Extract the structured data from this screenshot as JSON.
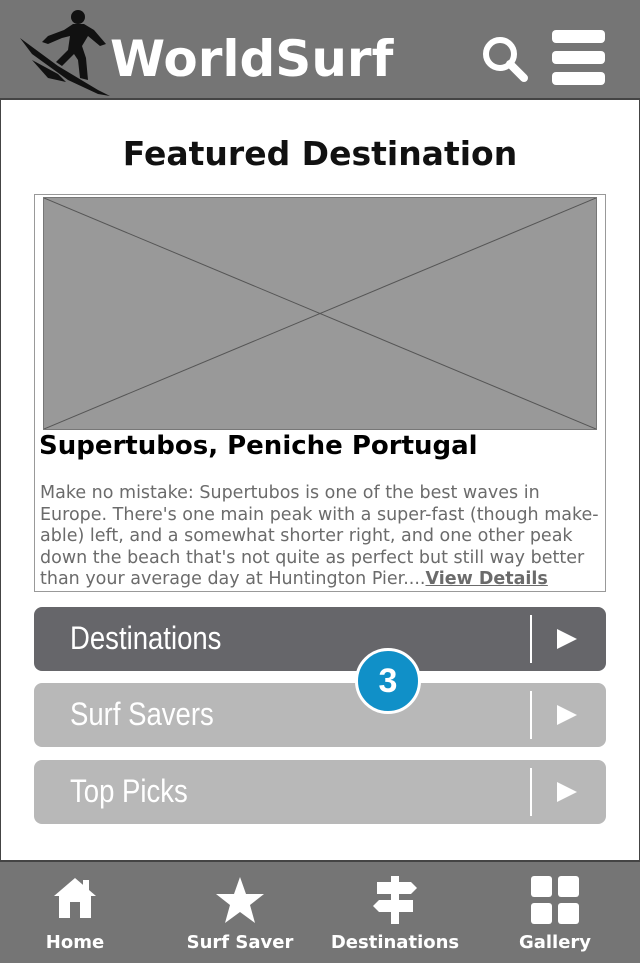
{
  "header": {
    "logo_text": "WorldSurf",
    "search_icon": "search-icon",
    "menu_icon": "hamburger-icon"
  },
  "featured": {
    "heading": "Featured Destination",
    "title": "Supertubos, Peniche Portugal",
    "description": "Make no mistake: Supertubos is one of the best waves in Europe. There's one main peak with a super-fast (though make-able) left, and a somewhat shorter right, and one other peak down the beach that's not quite as perfect but still way better than your average day at Huntington Pier....",
    "link_label": "View Details",
    "image_icon": "image-placeholder"
  },
  "menu": [
    {
      "label": "Destinations",
      "style": "dark"
    },
    {
      "label": "Surf Savers",
      "style": "light"
    },
    {
      "label": "Top Picks",
      "style": "light"
    }
  ],
  "badge": {
    "value": "3",
    "color": "#1090c8"
  },
  "bottom_nav": [
    {
      "label": "Home",
      "icon": "home-icon"
    },
    {
      "label": "Surf Saver",
      "icon": "star-icon"
    },
    {
      "label": "Destinations",
      "icon": "signpost-icon"
    },
    {
      "label": "Gallery",
      "icon": "grid-icon"
    }
  ],
  "colors": {
    "header_bg": "#757575",
    "button_dark": "#66666a",
    "button_light": "#b8b8b8",
    "badge": "#1090c8"
  }
}
